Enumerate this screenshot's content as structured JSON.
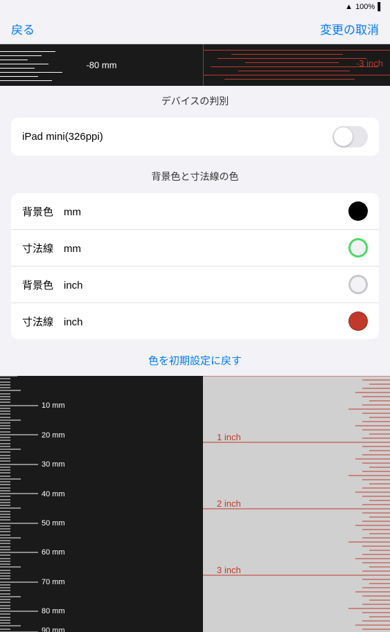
{
  "statusBar": {
    "wifi": "wifi",
    "battery": "100%"
  },
  "navBar": {
    "back": "戻る",
    "action": "変更の取消"
  },
  "rulerPreview": {
    "mmLabel": "-80 mm",
    "inchLabel": "-3 inch"
  },
  "deviceSection": {
    "header": "デバイスの判別",
    "device": "iPad mini(326ppi)"
  },
  "colorSection": {
    "header": "背景色と寸法線の色",
    "rows": [
      {
        "label": "背景色  mm",
        "colorClass": "color-black"
      },
      {
        "label": "寸法線  mm",
        "colorClass": "color-green-outline"
      },
      {
        "label": "背景色  inch",
        "colorClass": "color-gray-outline"
      },
      {
        "label": "寸法線  inch",
        "colorClass": "color-red"
      }
    ],
    "resetLabel": "色を初期設定に戻す"
  },
  "ruler": {
    "mmLabels": [
      {
        "val": "10 mm",
        "pos": 43
      },
      {
        "val": "20 mm",
        "pos": 86
      },
      {
        "val": "30 mm",
        "pos": 129
      },
      {
        "val": "40 mm",
        "pos": 172
      },
      {
        "val": "50 mm",
        "pos": 215
      },
      {
        "val": "60 mm",
        "pos": 258
      },
      {
        "val": "70 mm",
        "pos": 301
      },
      {
        "val": "80 mm",
        "pos": 344
      },
      {
        "val": "90 mm",
        "pos": 387
      }
    ],
    "inchLabels": [
      {
        "val": "1 inch",
        "pos": 96
      },
      {
        "val": "2 inch",
        "pos": 192
      },
      {
        "val": "3 inch",
        "pos": 288
      }
    ]
  }
}
